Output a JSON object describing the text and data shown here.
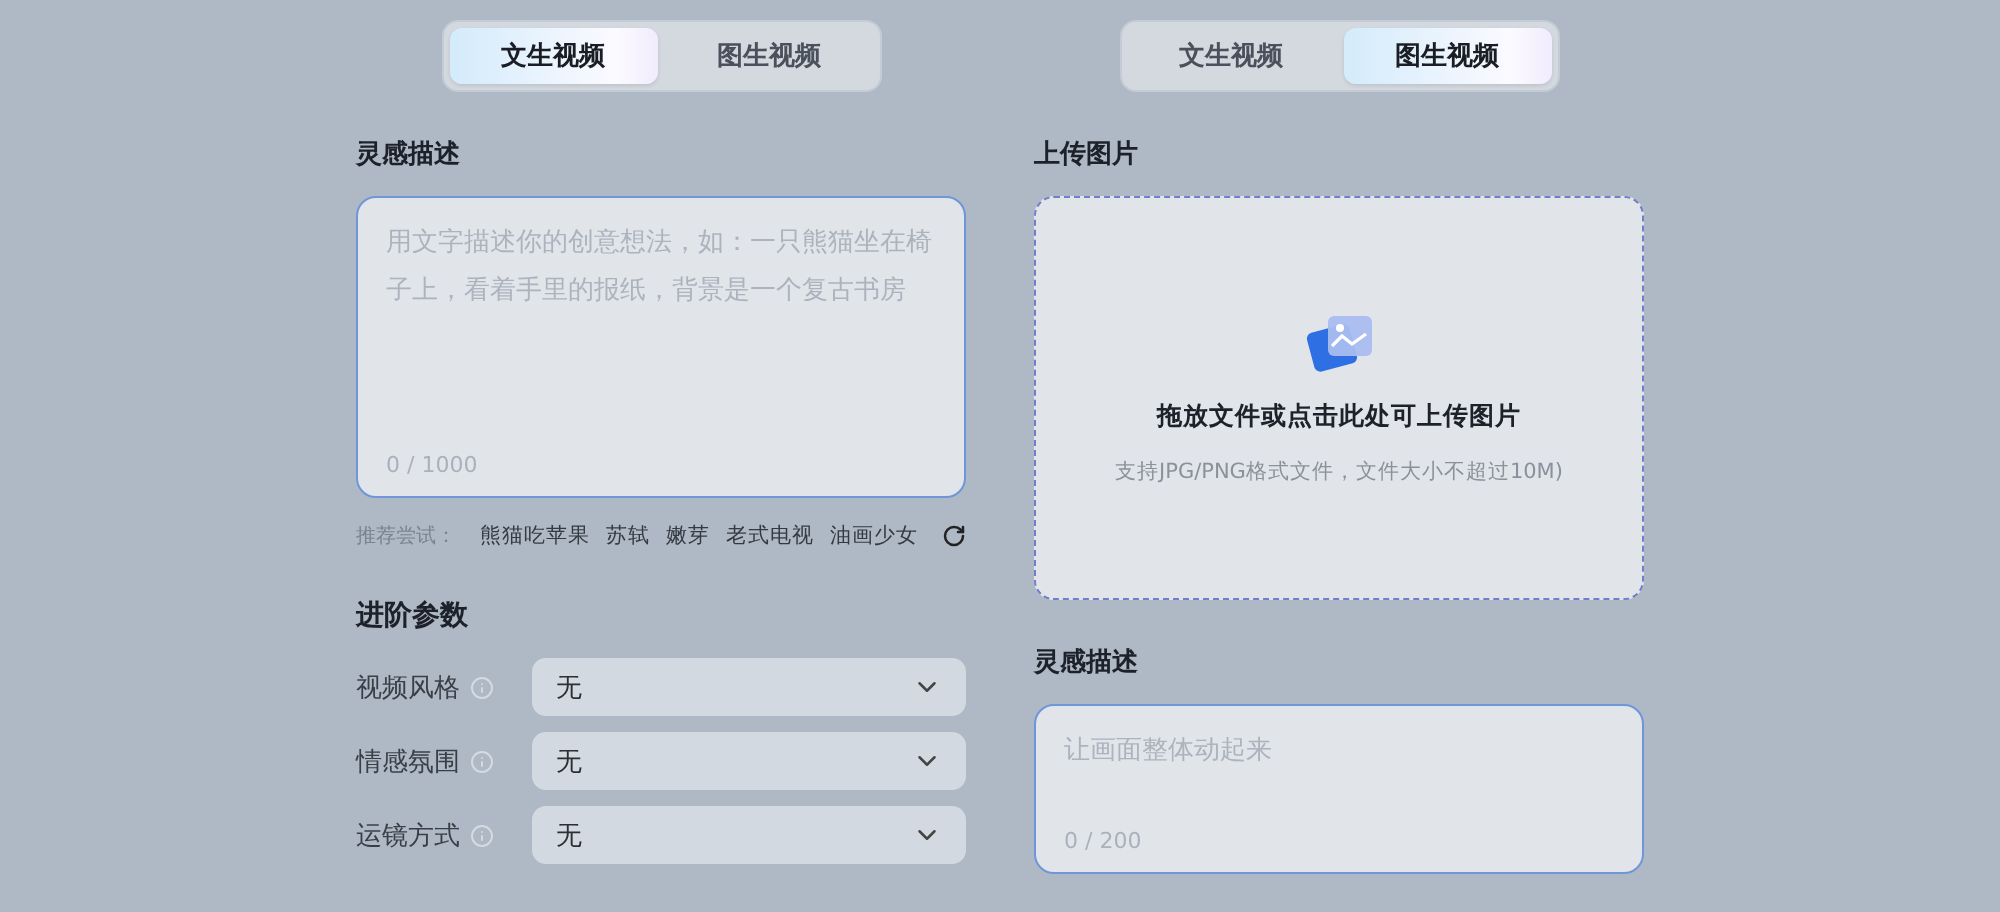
{
  "left_panel": {
    "tabs": [
      {
        "label": "文生视频",
        "selected": true
      },
      {
        "label": "图生视频",
        "selected": false
      }
    ],
    "prompt": {
      "label": "灵感描述",
      "placeholder": "用文字描述你的创意想法，如：一只熊猫坐在椅子上，看着手里的报纸，背景是一个复古书房",
      "counter": "0 / 1000"
    },
    "suggestions": {
      "label": "推荐尝试：",
      "items": [
        "熊猫吃苹果",
        "苏轼",
        "嫩芽",
        "老式电视",
        "油画少女"
      ]
    },
    "advanced": {
      "title": "进阶参数",
      "params": [
        {
          "label": "视频风格",
          "value": "无"
        },
        {
          "label": "情感氛围",
          "value": "无"
        },
        {
          "label": "运镜方式",
          "value": "无"
        }
      ]
    }
  },
  "right_panel": {
    "tabs": [
      {
        "label": "文生视频",
        "selected": false
      },
      {
        "label": "图生视频",
        "selected": true
      }
    ],
    "upload": {
      "label": "上传图片",
      "title": "拖放文件或点击此处可上传图片",
      "hint": "支持JPG/PNG格式文件，文件大小不超过10M)"
    },
    "prompt": {
      "label": "灵感描述",
      "placeholder": "让画面整体动起来",
      "counter": "0 / 200"
    }
  }
}
